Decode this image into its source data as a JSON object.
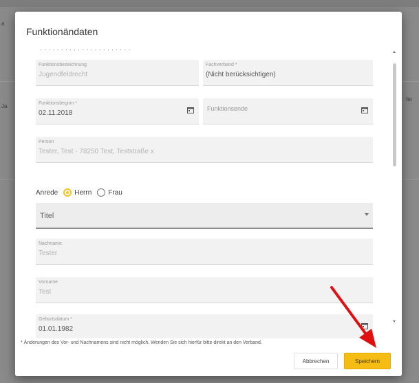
{
  "dialog": {
    "title": "Funktionändaten",
    "cut_text": "· · · · · · · · · · · · · · · · · · · · · ·",
    "fields": {
      "jugend": {
        "label": "Funktionsbezeichnung",
        "value": "Jugendfeldrecht"
      },
      "fachverband": {
        "label": "Fachverband *",
        "value": "(Nicht berücksichtigen)"
      },
      "funktionsbeginn": {
        "label": "Funktionsbeginn *",
        "value": "02.11.2018"
      },
      "funktionsende": {
        "placeholder": "Funktionsende"
      },
      "person": {
        "label": "Person",
        "value": "Tester, Test - 78250 Test, Teststraße x"
      },
      "titel": {
        "placeholder": "Titel"
      },
      "nachname": {
        "label": "Nachname",
        "value": "Tester"
      },
      "vorname": {
        "label": "Vorname",
        "value": "Test"
      },
      "geburtsdatum": {
        "label": "Geburtsdatum *",
        "value": "01.01.1982"
      }
    },
    "anrede": {
      "label": "Anrede",
      "options": [
        "Herrn",
        "Frau"
      ],
      "selected": "Herrn"
    },
    "footnote": "* Änderungen des Vor- und Nachnamens sind nicht möglich. Wenden Sie sich hierfür bitte direkt an den Verband.",
    "buttons": {
      "cancel": "Abbrechen",
      "save": "Speichern"
    }
  },
  "background": {
    "left_fragments": [
      "a",
      "Ja"
    ],
    "right_fragment": "fet"
  },
  "colors": {
    "accent": "#f5bd14",
    "arrow": "#e01010"
  }
}
